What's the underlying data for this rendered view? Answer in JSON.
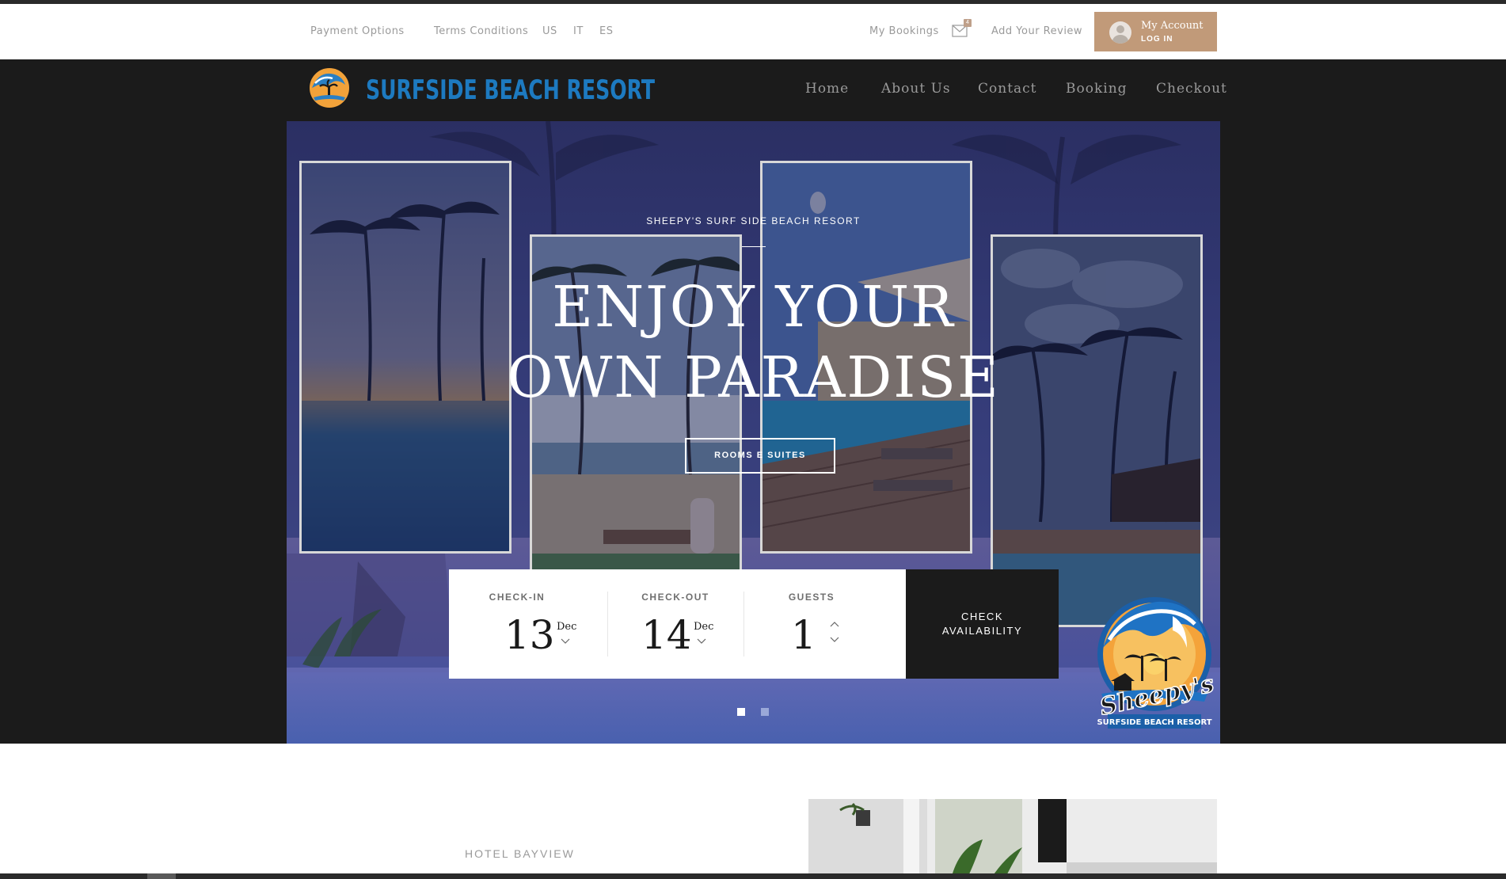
{
  "utility_bar": {
    "links_left": [
      "Payment Options",
      "Terms Conditions",
      "US",
      "IT",
      "ES"
    ],
    "my_bookings": "My Bookings",
    "mail_badge": "4",
    "add_review": "Add Your Review",
    "account": {
      "title": "My Account",
      "sub": "LOG IN"
    }
  },
  "header": {
    "logo_text": "Surfside Beach Resort",
    "nav": [
      "Home",
      "About Us",
      "Contact",
      "Booking",
      "Checkout"
    ]
  },
  "hero": {
    "subtitle": "Sheepy's Surf Side Beach Resort",
    "title_line1": "ENJOY YOUR",
    "title_line2": "OWN PARADISE",
    "button": "Rooms e Suites",
    "slides": 2,
    "active_slide": 1
  },
  "booking": {
    "checkin": {
      "label": "Check-In",
      "day": "13",
      "month": "Dec"
    },
    "checkout": {
      "label": "Check-Out",
      "day": "14",
      "month": "Dec"
    },
    "guests": {
      "label": "Guests",
      "count": "1"
    },
    "check_line1": "CHECK",
    "check_line2": "AVAILABILITY"
  },
  "seal": {
    "script": "Sheepy's",
    "caption": "SURFSIDE BEACH RESORT"
  },
  "section": {
    "label": "Hotel Bayview"
  },
  "colors": {
    "accent": "#c19a79",
    "logo_blue": "#1d7ac0",
    "dark": "#1b1b1b",
    "hero_overlay": "#2f3470"
  }
}
